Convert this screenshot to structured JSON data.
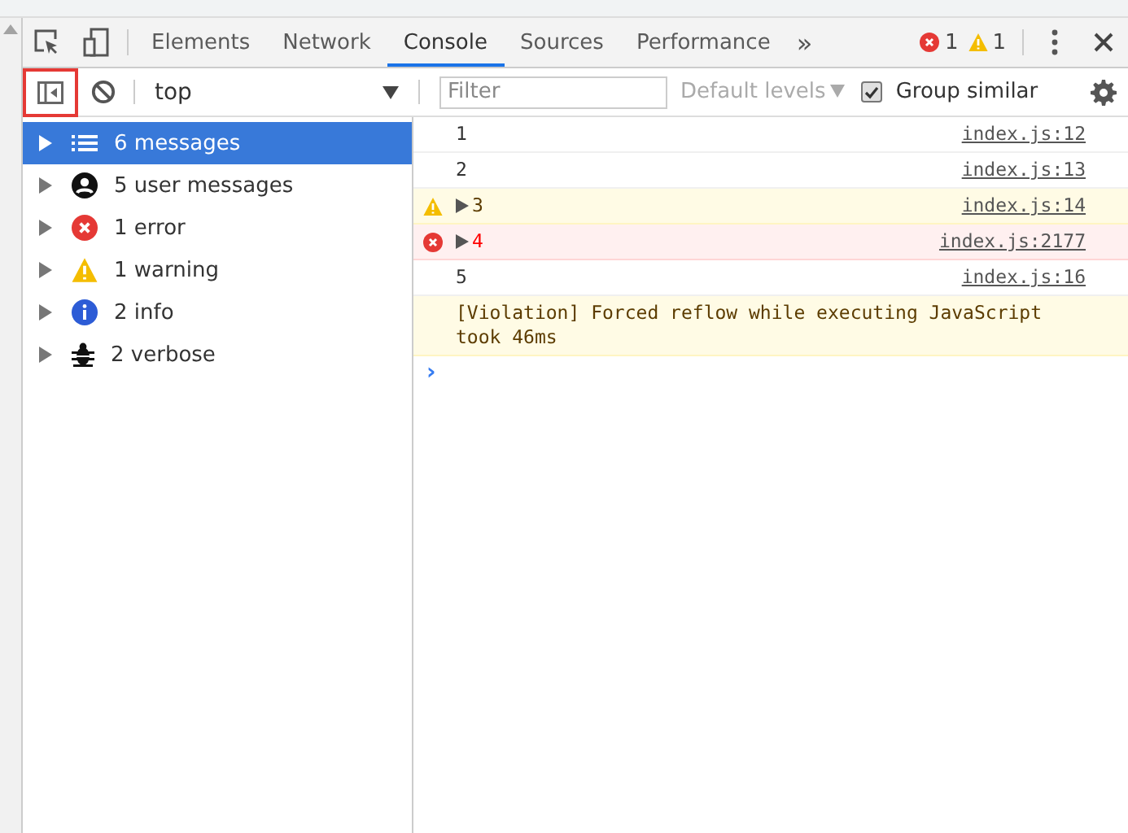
{
  "tabs": [
    {
      "label": "Elements",
      "selected": false
    },
    {
      "label": "Network",
      "selected": false
    },
    {
      "label": "Console",
      "selected": true
    },
    {
      "label": "Sources",
      "selected": false
    },
    {
      "label": "Performance",
      "selected": false
    }
  ],
  "more_tabs": "»",
  "counts": {
    "errors": "1",
    "warnings": "1"
  },
  "toolbar": {
    "sidebar_toggle_highlighted": true,
    "context": "top",
    "filter_placeholder": "Filter",
    "levels": "Default levels",
    "group_similar": {
      "label": "Group similar",
      "checked": true
    }
  },
  "sidebar": {
    "items": [
      {
        "kind": "all",
        "label": "6 messages",
        "selected": true
      },
      {
        "kind": "user",
        "label": "5 user messages",
        "selected": false
      },
      {
        "kind": "error",
        "label": "1 error",
        "selected": false
      },
      {
        "kind": "warning",
        "label": "1 warning",
        "selected": false
      },
      {
        "kind": "info",
        "label": "2 info",
        "selected": false
      },
      {
        "kind": "verbose",
        "label": "2 verbose",
        "selected": false
      }
    ]
  },
  "messages": [
    {
      "kind": "log",
      "text": "1",
      "source": "index.js:12",
      "expandable": false
    },
    {
      "kind": "log",
      "text": "2",
      "source": "index.js:13",
      "expandable": false
    },
    {
      "kind": "warning",
      "text": "3",
      "source": "index.js:14",
      "expandable": true
    },
    {
      "kind": "error",
      "text": "4",
      "source": "index.js:2177",
      "expandable": true
    },
    {
      "kind": "log",
      "text": "5",
      "source": "index.js:16",
      "expandable": false
    },
    {
      "kind": "violation",
      "text": "[Violation] Forced reflow while executing JavaScript took 46ms",
      "expandable": false
    }
  ],
  "prompt": "›"
}
